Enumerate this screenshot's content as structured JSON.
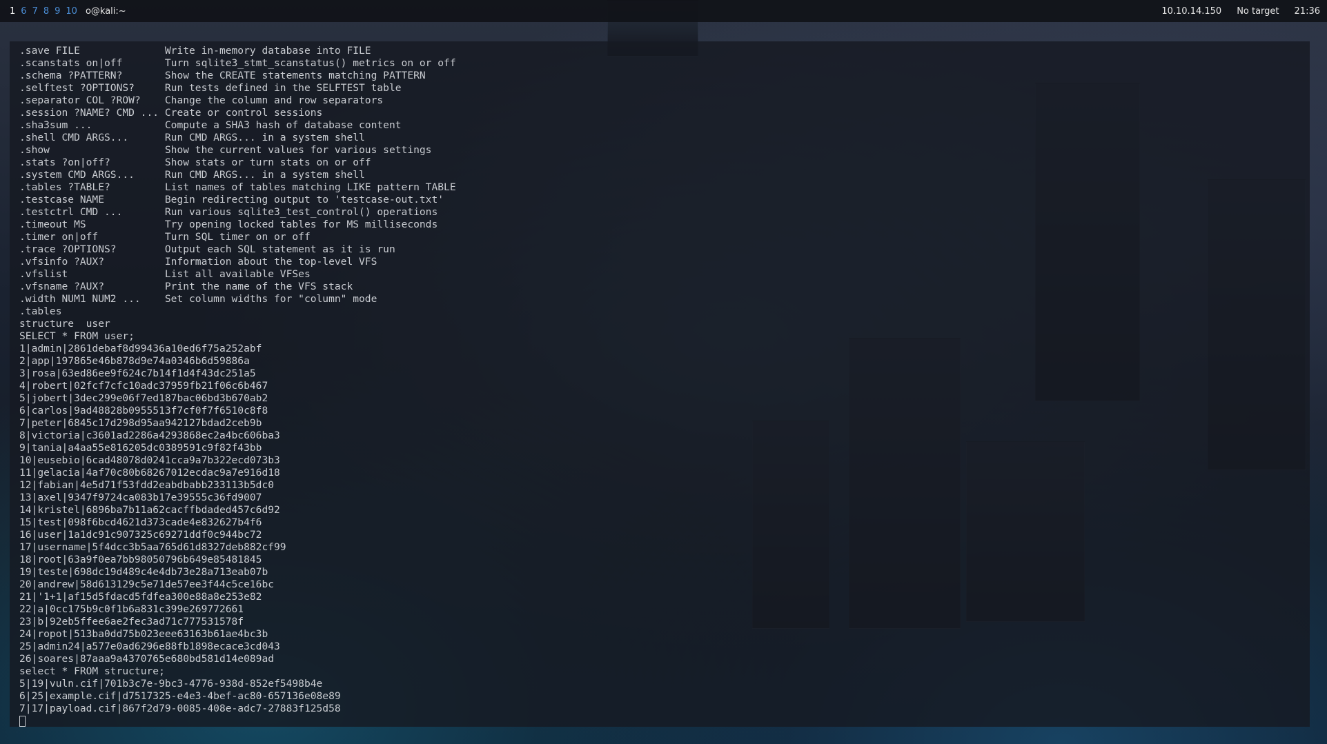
{
  "topbar": {
    "workspaces": [
      "1",
      "6",
      "7",
      "8",
      "9",
      "10"
    ],
    "active_workspace": "1",
    "window_title": "o@kali:~",
    "ip": "10.10.14.150",
    "target": "No target",
    "time": "21:36"
  },
  "terminal": {
    "lines": [
      ".save FILE              Write in-memory database into FILE",
      ".scanstats on|off       Turn sqlite3_stmt_scanstatus() metrics on or off",
      ".schema ?PATTERN?       Show the CREATE statements matching PATTERN",
      ".selftest ?OPTIONS?     Run tests defined in the SELFTEST table",
      ".separator COL ?ROW?    Change the column and row separators",
      ".session ?NAME? CMD ... Create or control sessions",
      ".sha3sum ...            Compute a SHA3 hash of database content",
      ".shell CMD ARGS...      Run CMD ARGS... in a system shell",
      ".show                   Show the current values for various settings",
      ".stats ?on|off?         Show stats or turn stats on or off",
      ".system CMD ARGS...     Run CMD ARGS... in a system shell",
      ".tables ?TABLE?         List names of tables matching LIKE pattern TABLE",
      ".testcase NAME          Begin redirecting output to 'testcase-out.txt'",
      ".testctrl CMD ...       Run various sqlite3_test_control() operations",
      ".timeout MS             Try opening locked tables for MS milliseconds",
      ".timer on|off           Turn SQL timer on or off",
      ".trace ?OPTIONS?        Output each SQL statement as it is run",
      ".vfsinfo ?AUX?          Information about the top-level VFS",
      ".vfslist                List all available VFSes",
      ".vfsname ?AUX?          Print the name of the VFS stack",
      ".width NUM1 NUM2 ...    Set column widths for \"column\" mode",
      ".tables",
      "structure  user",
      "SELECT * FROM user;",
      "1|admin|2861debaf8d99436a10ed6f75a252abf",
      "2|app|197865e46b878d9e74a0346b6d59886a",
      "3|rosa|63ed86ee9f624c7b14f1d4f43dc251a5",
      "4|robert|02fcf7cfc10adc37959fb21f06c6b467",
      "5|jobert|3dec299e06f7ed187bac06bd3b670ab2",
      "6|carlos|9ad48828b0955513f7cf0f7f6510c8f8",
      "7|peter|6845c17d298d95aa942127bdad2ceb9b",
      "8|victoria|c3601ad2286a4293868ec2a4bc606ba3",
      "9|tania|a4aa55e816205dc0389591c9f82f43bb",
      "10|eusebio|6cad48078d0241cca9a7b322ecd073b3",
      "11|gelacia|4af70c80b68267012ecdac9a7e916d18",
      "12|fabian|4e5d71f53fdd2eabdbabb233113b5dc0",
      "13|axel|9347f9724ca083b17e39555c36fd9007",
      "14|kristel|6896ba7b11a62cacffbdaded457c6d92",
      "15|test|098f6bcd4621d373cade4e832627b4f6",
      "16|user|1a1dc91c907325c69271ddf0c944bc72",
      "17|username|5f4dcc3b5aa765d61d8327deb882cf99",
      "18|root|63a9f0ea7bb98050796b649e85481845",
      "19|teste|698dc19d489c4e4db73e28a713eab07b",
      "20|andrew|58d613129c5e71de57ee3f44c5ce16bc",
      "21|'1+1|af15d5fdacd5fdfea300e88a8e253e82",
      "22|a|0cc175b9c0f1b6a831c399e269772661",
      "23|b|92eb5ffee6ae2fec3ad71c777531578f",
      "24|ropot|513ba0dd75b023eee63163b61ae4bc3b",
      "25|admin24|a577e0ad6296e88fb1898ecace3cd043",
      "26|soares|87aaa9a4370765e680bd581d14e089ad",
      "select * FROM structure;",
      "5|19|vuln.cif|701b3c7e-9bc3-4776-938d-852ef5498b4e",
      "6|25|example.cif|d7517325-e4e3-4bef-ac80-657136e08e89",
      "7|17|payload.cif|867f2d79-0085-408e-adc7-27883f125d58"
    ]
  }
}
